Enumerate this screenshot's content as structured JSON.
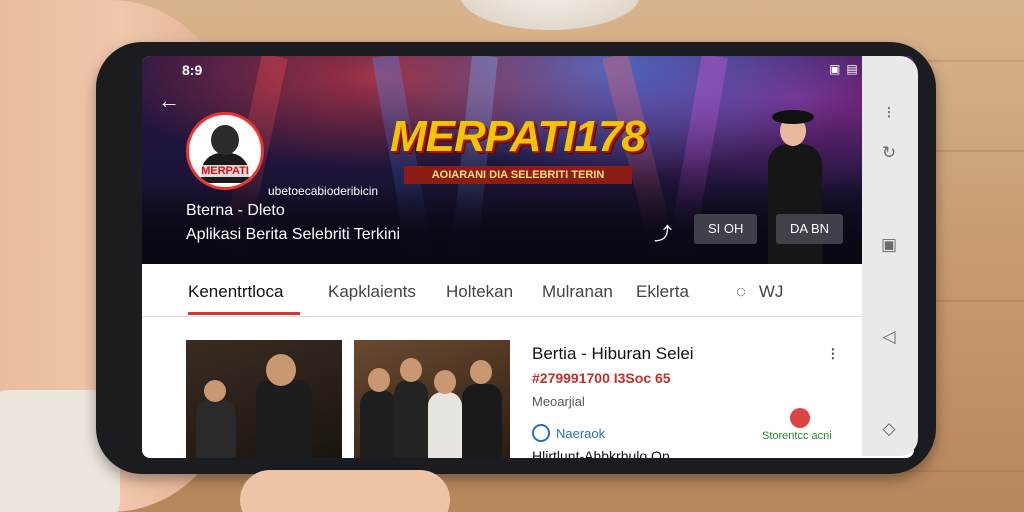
{
  "status": {
    "time": "8:9",
    "icons": [
      "gallery-icon",
      "cast-icon",
      "wifi-icon",
      "signal-icon",
      "battery-icon"
    ]
  },
  "channel": {
    "avatar_label": "MERPATI",
    "brand": "MERPATI178",
    "brand_sub": "AOIARANI DIA SELEBRITI TERIN",
    "handle": "ubetoecabioderibicin",
    "name": "Bterna - Dleto",
    "description": "Aplikasi Berita Selebriti Terkini",
    "btn_left": "SI OH",
    "btn_right": "DA BN"
  },
  "tabs": [
    {
      "label": "Kenentrtloca",
      "active": true
    },
    {
      "label": "Kapklaients",
      "active": false
    },
    {
      "label": "Holtekan",
      "active": false
    },
    {
      "label": "Mulranan",
      "active": false
    },
    {
      "label": "Eklerta",
      "active": false
    },
    {
      "label": "WJ",
      "active": false
    }
  ],
  "video": {
    "title": "Bertia - Hiburan Selei",
    "meta": "#279991700 I3Soc 65",
    "sub": "Meoarjial",
    "channel": "Naeraok",
    "note": "Storentcc acni",
    "cutoff": "Hlirtlunt-Ahbkrhulo On"
  },
  "colors": {
    "accent": "#d03a2f",
    "brand": "#f5c400"
  }
}
